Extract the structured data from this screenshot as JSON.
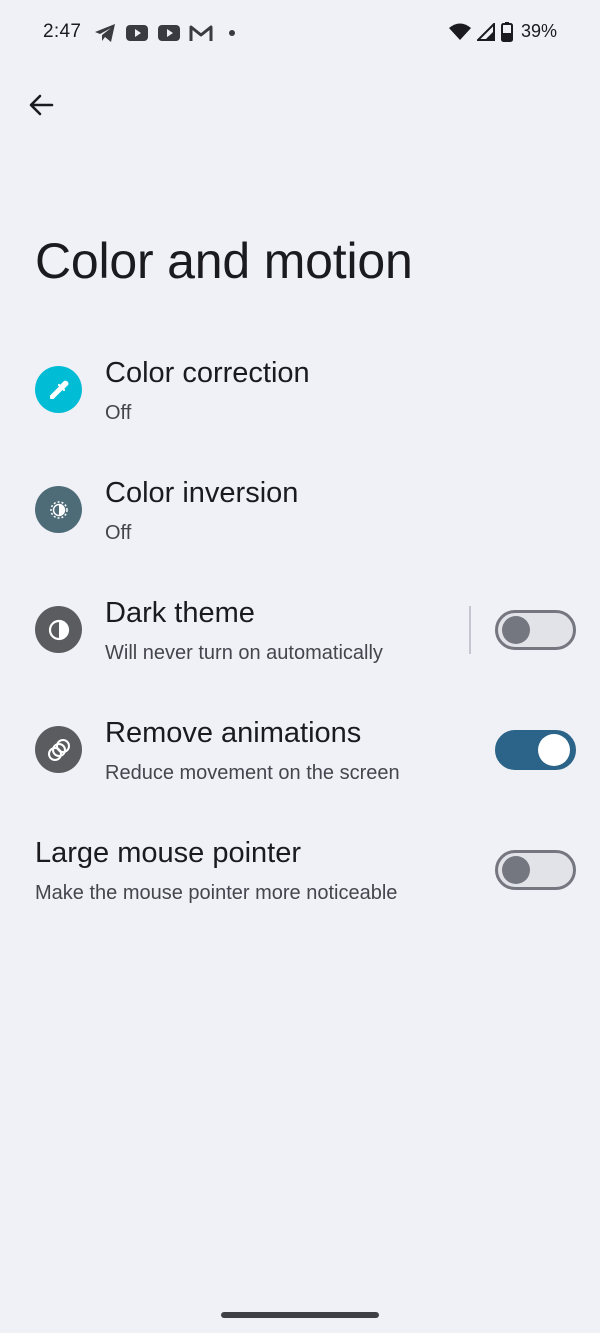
{
  "status_bar": {
    "time": "2:47",
    "notifications": [
      "telegram-icon",
      "youtube-icon",
      "youtube-icon",
      "gmail-icon",
      "dot-icon"
    ],
    "system": [
      "wifi-icon",
      "cellular-signal-icon",
      "battery-icon"
    ],
    "battery": "39%"
  },
  "header": {
    "back_icon": "arrow-back-icon",
    "title": "Color and motion"
  },
  "colors": {
    "background": "#f0f1f6",
    "switch_on": "#2b6488",
    "color_correction_icon_bg": "#00bcd4",
    "color_inversion_icon_bg": "#4e6b78",
    "dark_theme_icon_bg": "#5b5c60"
  },
  "prefs": [
    {
      "title": "Color correction",
      "summary": "Off",
      "icon": "eyedropper-icon"
    },
    {
      "title": "Color inversion",
      "summary": "Off",
      "icon": "color-inversion-icon"
    },
    {
      "title": "Dark theme",
      "summary": "Will never turn on automatically",
      "icon": "contrast-icon",
      "switch": "off"
    },
    {
      "title": "Remove animations",
      "summary": "Reduce movement on the screen",
      "icon": "animation-icon",
      "switch": "on"
    },
    {
      "title": "Large mouse pointer",
      "summary": "Make the mouse pointer more noticeable",
      "switch": "off"
    }
  ]
}
